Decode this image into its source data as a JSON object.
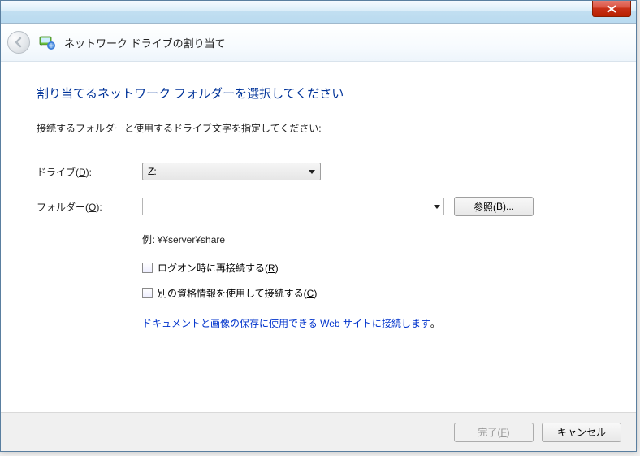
{
  "titlebar": {
    "close_tooltip": "閉じる"
  },
  "header": {
    "title": "ネットワーク ドライブの割り当て"
  },
  "content": {
    "heading": "割り当てるネットワーク フォルダーを選択してください",
    "subtext": "接続するフォルダーと使用するドライブ文字を指定してください:",
    "drive_label_pre": "ドライブ(",
    "drive_label_key": "D",
    "drive_label_post": "):",
    "drive_value": "Z:",
    "folder_label_pre": "フォルダー(",
    "folder_label_key": "O",
    "folder_label_post": "):",
    "folder_value": "",
    "browse_label_pre": "参照(",
    "browse_label_key": "B",
    "browse_label_post": ")...",
    "example": "例: ¥¥server¥share",
    "reconnect_label_pre": "ログオン時に再接続する(",
    "reconnect_label_key": "R",
    "reconnect_label_post": ")",
    "creds_label_pre": "別の資格情報を使用して接続する(",
    "creds_label_key": "C",
    "creds_label_post": ")",
    "link_text": "ドキュメントと画像の保存に使用できる Web サイトに接続します",
    "link_suffix": "。"
  },
  "footer": {
    "finish_label_pre": "完了(",
    "finish_label_key": "F",
    "finish_label_post": ")",
    "cancel_label": "キャンセル"
  }
}
